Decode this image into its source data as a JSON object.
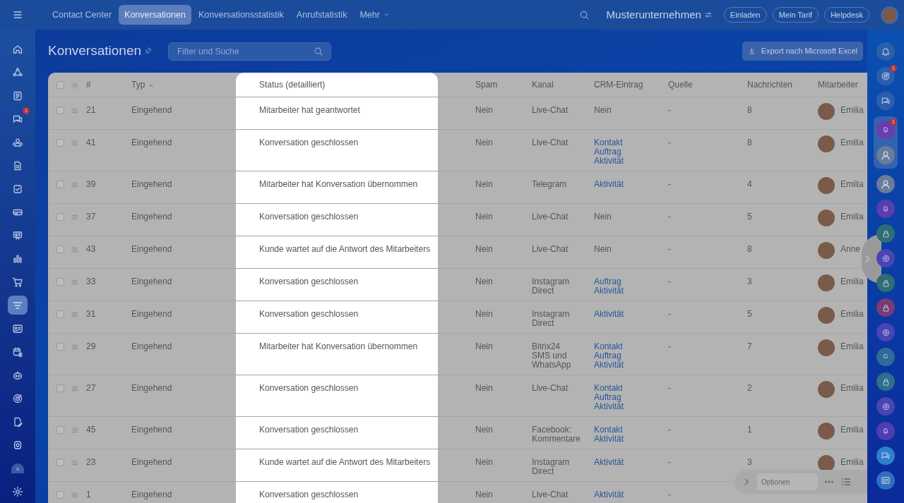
{
  "top_nav": {
    "tabs": [
      {
        "label": "Contact Center",
        "selected": false
      },
      {
        "label": "Konversationen",
        "selected": true
      },
      {
        "label": "Konversationsstatistik",
        "selected": false
      },
      {
        "label": "Anrufstatistik",
        "selected": false
      },
      {
        "label": "Mehr",
        "selected": false
      }
    ],
    "company": "Musterunternehmen",
    "buttons": [
      "Einladen",
      "Mein Tarif",
      "Helpdesk"
    ]
  },
  "left_sidebar": {
    "items": [
      {
        "kind": "icon",
        "selected": false
      },
      {
        "kind": "icon",
        "selected": false
      },
      {
        "kind": "icon",
        "selected": false
      },
      {
        "kind": "icon",
        "selected": false,
        "badge": "1"
      },
      {
        "kind": "icon",
        "selected": false
      },
      {
        "kind": "icon",
        "selected": false
      },
      {
        "kind": "icon",
        "selected": false
      },
      {
        "kind": "icon",
        "selected": false
      },
      {
        "kind": "icon",
        "selected": false
      },
      {
        "kind": "icon",
        "selected": false
      },
      {
        "kind": "icon",
        "selected": false
      },
      {
        "kind": "icon",
        "selected": true
      },
      {
        "kind": "icon",
        "selected": false
      },
      {
        "kind": "icon",
        "selected": false
      },
      {
        "kind": "icon",
        "selected": false
      },
      {
        "kind": "icon",
        "selected": false
      },
      {
        "kind": "icon",
        "selected": false
      },
      {
        "kind": "icon",
        "selected": false
      },
      {
        "kind": "letter",
        "text": "s",
        "selected": false
      },
      {
        "kind": "icon",
        "selected": false
      }
    ]
  },
  "page": {
    "title": "Konversationen",
    "search": {
      "placeholder": "Filter und Suche"
    },
    "export_button": "Export nach Microsoft Excel"
  },
  "table": {
    "select_all": {
      "checked": false
    },
    "columns": [
      {
        "label": "#",
        "sorted": false
      },
      {
        "label": "Typ",
        "sorted": true
      },
      {
        "label": "Status (detailliert)",
        "sorted": false
      },
      {
        "label": "Spam",
        "sorted": false
      },
      {
        "label": "Kanal",
        "sorted": false
      },
      {
        "label": "CRM-Eintrag",
        "sorted": false
      },
      {
        "label": "Quelle",
        "sorted": false
      },
      {
        "label": "Nachrichten",
        "sorted": false
      },
      {
        "label": "Mitarbeiter",
        "sorted": false
      }
    ],
    "rows": [
      {
        "checked": false,
        "id": "21",
        "type": "Eingehend",
        "status": "Mitarbeiter hat geantwortet",
        "spam": "Nein",
        "channel": "Live-Chat",
        "crm": [
          {
            "kind": "text",
            "label": "Nein"
          }
        ],
        "source": "-",
        "messages": "8",
        "employee": "Emilia"
      },
      {
        "checked": false,
        "id": "41",
        "type": "Eingehend",
        "status": "Konversation geschlossen",
        "spam": "Nein",
        "channel": "Live-Chat",
        "crm": [
          {
            "kind": "link",
            "label": "Kontakt"
          },
          {
            "kind": "link",
            "label": "Auftrag"
          },
          {
            "kind": "link",
            "label": "Aktivität"
          }
        ],
        "source": "-",
        "messages": "8",
        "employee": "Emilia"
      },
      {
        "checked": false,
        "id": "39",
        "type": "Eingehend",
        "status": "Mitarbeiter hat Konversation übernommen",
        "spam": "Nein",
        "channel": "Telegram",
        "crm": [
          {
            "kind": "link",
            "label": "Aktivität"
          }
        ],
        "source": "-",
        "messages": "4",
        "employee": "Emilia"
      },
      {
        "checked": false,
        "id": "37",
        "type": "Eingehend",
        "status": "Konversation geschlossen",
        "spam": "Nein",
        "channel": "Live-Chat",
        "crm": [
          {
            "kind": "text",
            "label": "Nein"
          }
        ],
        "source": "-",
        "messages": "5",
        "employee": "Emilia"
      },
      {
        "checked": false,
        "id": "43",
        "type": "Eingehend",
        "status": "Kunde wartet auf die Antwort des Mitarbeiters",
        "spam": "Nein",
        "channel": "Live-Chat",
        "crm": [
          {
            "kind": "text",
            "label": "Nein"
          }
        ],
        "source": "-",
        "messages": "8",
        "employee": "Anne"
      },
      {
        "checked": false,
        "id": "33",
        "type": "Eingehend",
        "status": "Konversation geschlossen",
        "spam": "Nein",
        "channel": "Instagram Direct",
        "crm": [
          {
            "kind": "link",
            "label": "Auftrag"
          },
          {
            "kind": "link",
            "label": "Aktivität"
          }
        ],
        "source": "-",
        "messages": "3",
        "employee": "Emilia"
      },
      {
        "checked": false,
        "id": "31",
        "type": "Eingehend",
        "status": "Konversation geschlossen",
        "spam": "Nein",
        "channel": "Instagram Direct",
        "crm": [
          {
            "kind": "link",
            "label": "Aktivität"
          }
        ],
        "source": "-",
        "messages": "5",
        "employee": "Emilia"
      },
      {
        "checked": false,
        "id": "29",
        "type": "Eingehend",
        "status": "Mitarbeiter hat Konversation übernommen",
        "spam": "Nein",
        "channel": "Bitrix24 SMS und WhatsApp",
        "crm": [
          {
            "kind": "link",
            "label": "Kontakt"
          },
          {
            "kind": "link",
            "label": "Auftrag"
          },
          {
            "kind": "link",
            "label": "Aktivität"
          }
        ],
        "source": "-",
        "messages": "7",
        "employee": "Emilia"
      },
      {
        "checked": false,
        "id": "27",
        "type": "Eingehend",
        "status": "Konversation geschlossen",
        "spam": "Nein",
        "channel": "Live-Chat",
        "crm": [
          {
            "kind": "link",
            "label": "Kontakt"
          },
          {
            "kind": "link",
            "label": "Auftrag"
          },
          {
            "kind": "link",
            "label": "Aktivität"
          }
        ],
        "source": "-",
        "messages": "2",
        "employee": "Emilia"
      },
      {
        "checked": false,
        "id": "45",
        "type": "Eingehend",
        "status": "Konversation geschlossen",
        "spam": "Nein",
        "channel": "Facebook: Kommentare",
        "crm": [
          {
            "kind": "link",
            "label": "Kontakt"
          },
          {
            "kind": "link",
            "label": "Aktivität"
          }
        ],
        "source": "-",
        "messages": "1",
        "employee": "Emilia"
      },
      {
        "checked": false,
        "id": "23",
        "type": "Eingehend",
        "status": "Kunde wartet auf die Antwort des Mitarbeiters",
        "spam": "Nein",
        "channel": "Instagram Direct",
        "crm": [
          {
            "kind": "link",
            "label": "Aktivität"
          }
        ],
        "source": "-",
        "messages": "3",
        "employee": "Emilia"
      },
      {
        "checked": false,
        "id": "1",
        "type": "Eingehend",
        "status": "Konversation geschlossen",
        "spam": "Nein",
        "channel": "Live-Chat",
        "crm": [
          {
            "kind": "link",
            "label": "Aktivität"
          }
        ],
        "source": "-"
      }
    ]
  },
  "options_panel": {
    "placeholder": "Optionen"
  },
  "right_sidebar": {
    "items": [
      {
        "kind": "bell"
      },
      {
        "kind": "target",
        "badge": "1"
      },
      {
        "kind": "chat"
      },
      {
        "kind": "app",
        "color": "#6a3cb0",
        "badge": "1"
      },
      {
        "kind": "avatar"
      },
      {
        "kind": "avatar"
      },
      {
        "kind": "app",
        "color": "#5a3db0"
      },
      {
        "kind": "lock",
        "color": "#2f6d74"
      },
      {
        "kind": "ring",
        "color": "#4a44b4"
      },
      {
        "kind": "lock",
        "color": "#2f6d74"
      },
      {
        "kind": "lock",
        "color": "#7a3b75"
      },
      {
        "kind": "ring",
        "color": "#4a44b4"
      },
      {
        "kind": "letter",
        "color": "#2f6a98",
        "text": "G"
      },
      {
        "kind": "lock",
        "color": "#2f6d8c"
      },
      {
        "kind": "ring",
        "color": "#4a44b4"
      },
      {
        "kind": "app",
        "color": "#4f3db4"
      },
      {
        "kind": "chat",
        "color": "#2f7fd0"
      },
      {
        "kind": "card",
        "color": "#2f6fc0"
      }
    ]
  }
}
